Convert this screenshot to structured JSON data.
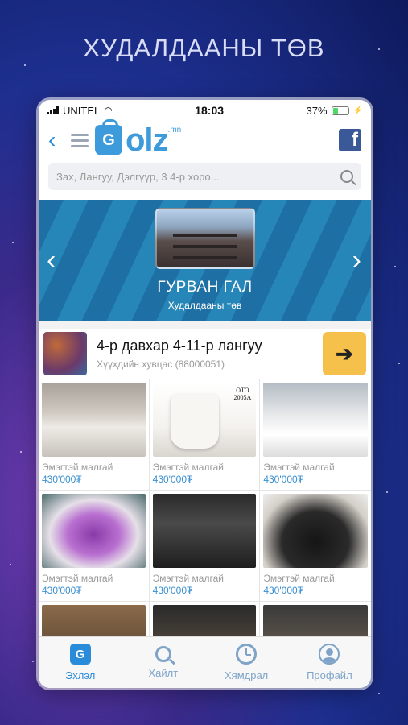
{
  "headline": "ХУДАЛДААНЫ ТӨВ",
  "status_bar": {
    "carrier": "UNITEL",
    "time": "18:03",
    "battery": "37%"
  },
  "header": {
    "logo_text": "olz",
    "logo_suffix": ".mn",
    "facebook_label": "f"
  },
  "search": {
    "placeholder": "Зах, Лангуу, Дэлгүүр, 3 4-р хоро..."
  },
  "hero": {
    "title": "ГУРВАН ГАЛ",
    "subtitle": "Худалдааны төв"
  },
  "shop": {
    "title": "4-р давхар 4-11-р лангуу",
    "subtitle": "Хүүхдийн хувцас (88000051)",
    "arrow": "➔"
  },
  "products": [
    {
      "name": "Эмэгтэй малгай",
      "price": "430'000₮"
    },
    {
      "name": "Эмэгтэй малгай",
      "price": "430'000₮"
    },
    {
      "name": "Эмэгтэй малгай",
      "price": "430'000₮"
    },
    {
      "name": "Эмэгтэй малгай",
      "price": "430'000₮"
    },
    {
      "name": "Эмэгтэй малгай",
      "price": "430'000₮"
    },
    {
      "name": "Эмэгтэй малгай",
      "price": "430'000₮"
    }
  ],
  "product_overlay": {
    "oto_line1": "OTO",
    "oto_line2": "2005A"
  },
  "tabs": [
    {
      "label": "Эхлэл",
      "icon": "home-icon",
      "active": true
    },
    {
      "label": "Хайлт",
      "icon": "search-icon",
      "active": false
    },
    {
      "label": "Хямдрал",
      "icon": "clock-icon",
      "active": false
    },
    {
      "label": "Профайл",
      "icon": "profile-icon",
      "active": false
    }
  ],
  "colors": {
    "accent": "#2a8bd8",
    "cta": "#f5c14b",
    "price": "#3a8fd0"
  }
}
